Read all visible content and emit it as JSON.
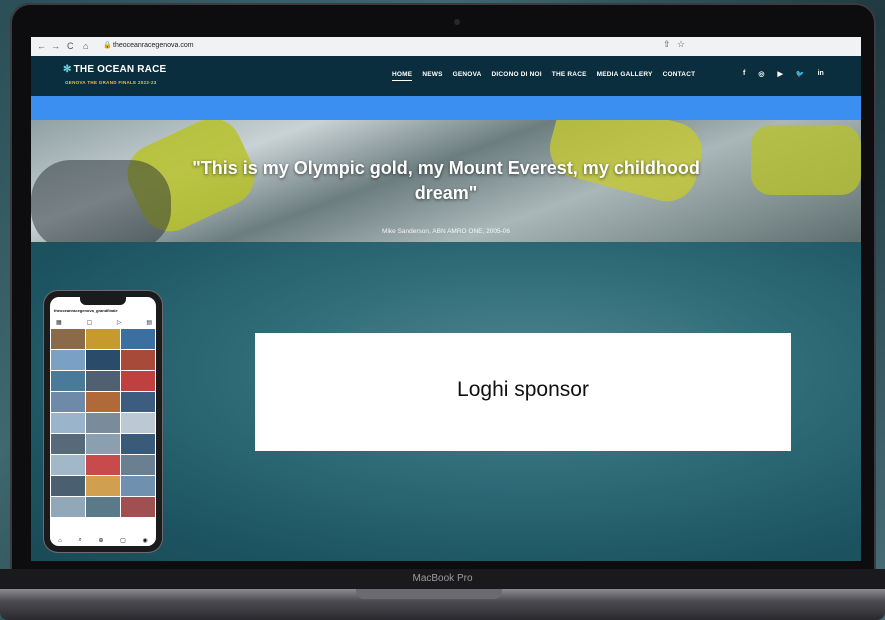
{
  "browser": {
    "back": "←",
    "forward": "→",
    "reload": "C",
    "home": "⌂",
    "lock": "🔒",
    "url": "theoceanracegenova.com",
    "share": "⇧",
    "star": "☆"
  },
  "site": {
    "logo_text": "THE OCEAN RACE",
    "logo_sub": "GENOVA THE GRAND FINALE 2022-23",
    "nav": [
      "HOME",
      "NEWS",
      "GENOVA",
      "DICONO DI NOI",
      "THE RACE",
      "MEDIA GALLERY",
      "CONTACT"
    ],
    "social": [
      "f",
      "◎",
      "▶",
      "🐦",
      "in"
    ]
  },
  "hero": {
    "quote": "\"This is my Olympic gold, my Mount Everest, my childhood dream\"",
    "caption": "Mike Sanderson, ABN AMRO ONE, 2005-06"
  },
  "sponsor": {
    "label": "Loghi sponsor"
  },
  "phone": {
    "handle": "theoceanracegenova_grandfinale",
    "tabs": [
      "▦",
      "▢",
      "▷",
      "▤"
    ],
    "bottom": [
      "⌂",
      "⌕",
      "⊕",
      "▢",
      "◉"
    ]
  },
  "device": {
    "label": "MacBook Pro"
  },
  "colors": {
    "header": "#0a2e3e",
    "band": "#3b8ff0",
    "teal": "#2e6b77"
  }
}
